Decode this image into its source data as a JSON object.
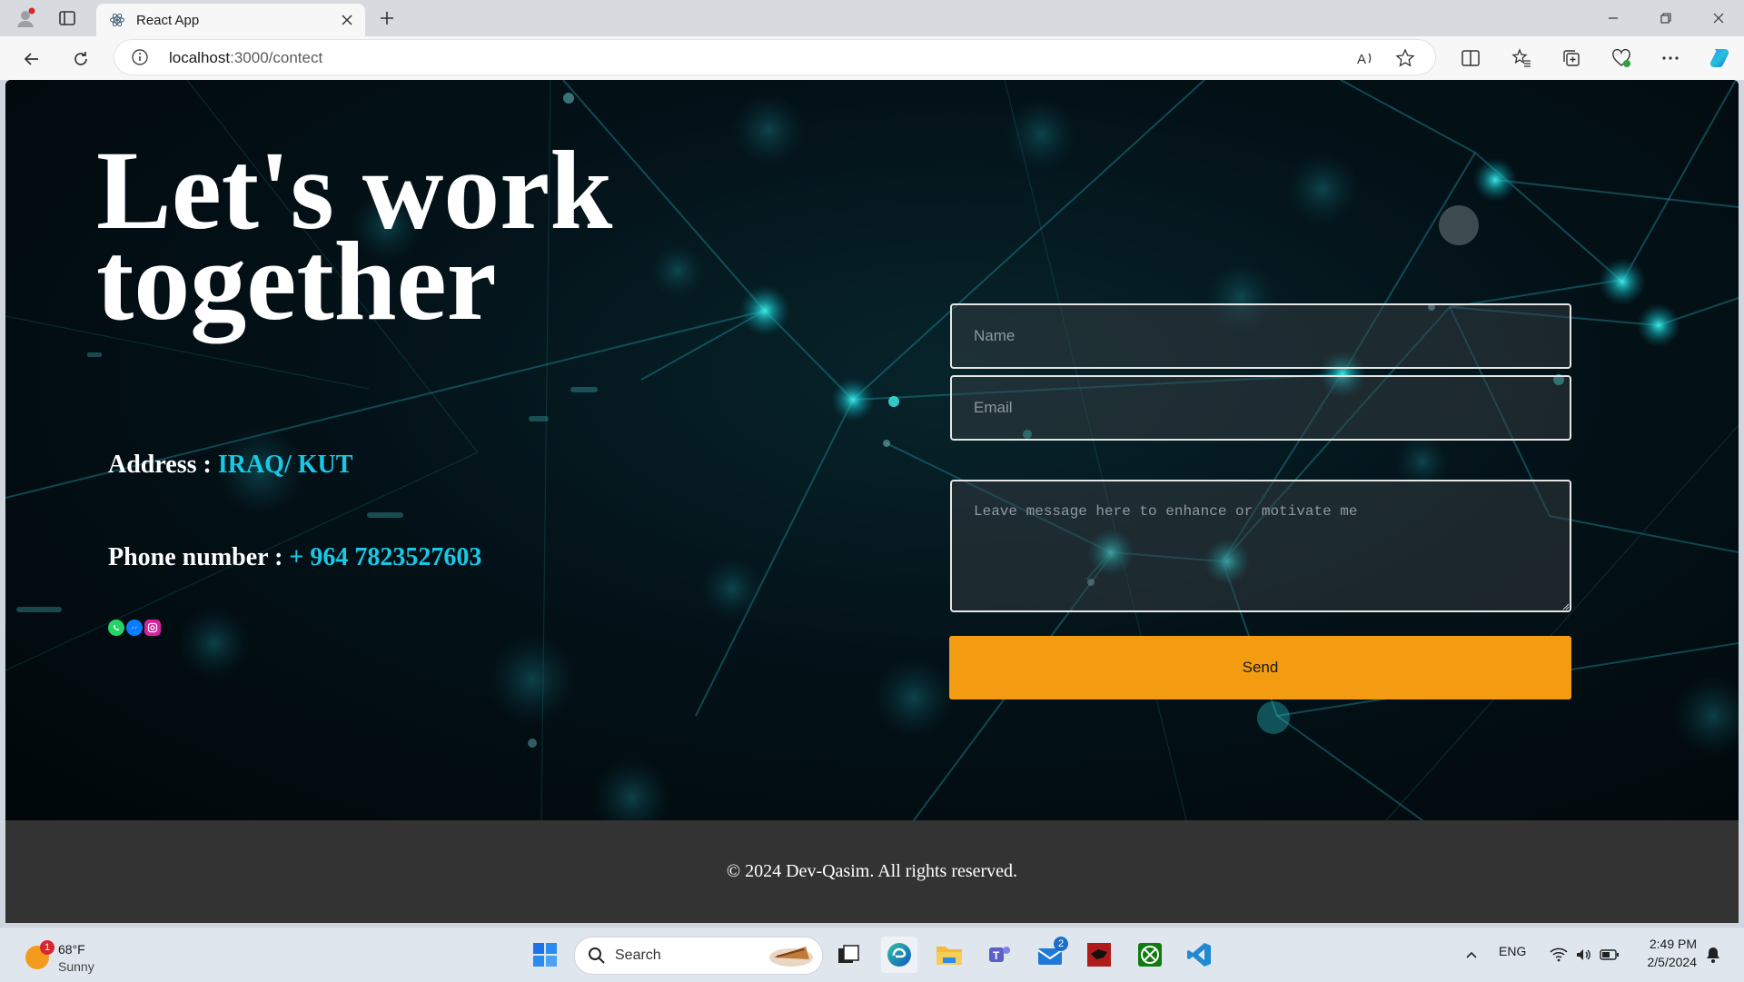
{
  "browser": {
    "tab_title": "React App",
    "url_host": "localhost",
    "url_path": ":3000/contect"
  },
  "page": {
    "headline_line1": "Let's work",
    "headline_line2": "together",
    "address_label": "Address : ",
    "address_value": "IRAQ/ KUT",
    "phone_label": "Phone number : ",
    "phone_value": "+ 964 7823527603",
    "socials": [
      "whatsapp-icon",
      "messenger-icon",
      "instagram-icon"
    ],
    "form": {
      "name_placeholder": "Name",
      "email_placeholder": "Email",
      "message_placeholder": "Leave message here to enhance or motivate me",
      "send_label": "Send"
    },
    "footer": "© 2024 Dev-Qasim. All rights reserved.",
    "colors": {
      "accent": "#18c9e6",
      "send_button": "#f39c12",
      "footer_bg": "#333333"
    }
  },
  "taskbar": {
    "weather_temp": "68°F",
    "weather_cond": "Sunny",
    "weather_badge": "1",
    "search_label": "Search",
    "mail_badge": "2",
    "language": "ENG",
    "time": "2:49 PM",
    "date": "2/5/2024"
  }
}
